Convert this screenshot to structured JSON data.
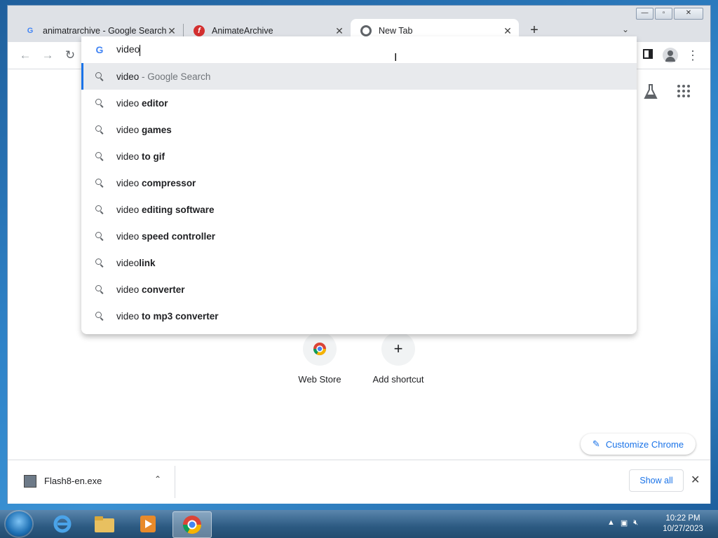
{
  "window": {
    "controls": {
      "minimize": "—",
      "restore": "▫",
      "close": "✕"
    }
  },
  "tabs": [
    {
      "title": "animatrarchive - Google Search",
      "favicon": "google-icon",
      "close": "✕"
    },
    {
      "title": "AnimateArchive",
      "favicon": "flash-icon",
      "close": "✕"
    },
    {
      "title": "New Tab",
      "favicon": "chrome-icon",
      "close": "✕"
    }
  ],
  "new_tab_label": "+",
  "tab_search_label": "⌄",
  "toolbar": {
    "back": "←",
    "forward": "→",
    "reload": "↻",
    "menu": "⋮"
  },
  "omnibox": {
    "value": "video",
    "suggestions": [
      {
        "prefix": "video",
        "bold": "",
        "desc": " - Google Search"
      },
      {
        "prefix": "video ",
        "bold": "editor",
        "desc": ""
      },
      {
        "prefix": "video ",
        "bold": "games",
        "desc": ""
      },
      {
        "prefix": "video ",
        "bold": "to gif",
        "desc": ""
      },
      {
        "prefix": "video ",
        "bold": "compressor",
        "desc": ""
      },
      {
        "prefix": "video ",
        "bold": "editing software",
        "desc": ""
      },
      {
        "prefix": "video ",
        "bold": "speed controller",
        "desc": ""
      },
      {
        "prefix": "video",
        "bold": "link",
        "desc": ""
      },
      {
        "prefix": "video ",
        "bold": "converter",
        "desc": ""
      },
      {
        "prefix": "video ",
        "bold": "to mp3 converter",
        "desc": ""
      }
    ]
  },
  "shortcuts": [
    {
      "label": "Web Store",
      "icon": "web-store-icon"
    },
    {
      "label": "Add shortcut",
      "icon": "+"
    }
  ],
  "customize": {
    "label": "Customize Chrome",
    "icon": "✎"
  },
  "downloads": {
    "file_name": "Flash8-en.exe",
    "chevron": "⌃",
    "show_all": "Show all",
    "close": "✕"
  },
  "taskbar": {
    "time": "10:22 PM",
    "date": "10/27/2023",
    "apps": [
      "internet-explorer-icon",
      "file-explorer-icon",
      "media-player-icon",
      "chrome-icon"
    ]
  },
  "colors": {
    "accent": "#1a73e8",
    "selected_row": "#e8eaed"
  }
}
